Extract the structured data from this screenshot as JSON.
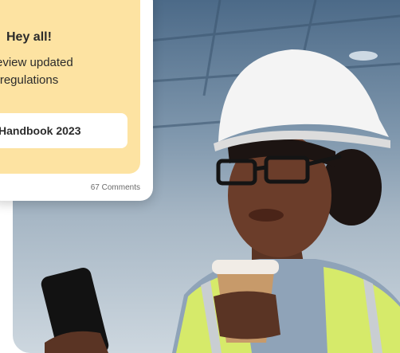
{
  "post": {
    "greeting": "Hey all!",
    "body_line1": "review updated",
    "body_line2": "ty regulations",
    "attachment_label": "Handbook 2023",
    "comments": "67 Comments"
  },
  "colors": {
    "card_background": "#fde3a2",
    "card_frame": "#ffffff",
    "text": "#2b2b2b",
    "hard_hat": "#f4f4f4",
    "safety_vest": "#d6ea6a"
  }
}
